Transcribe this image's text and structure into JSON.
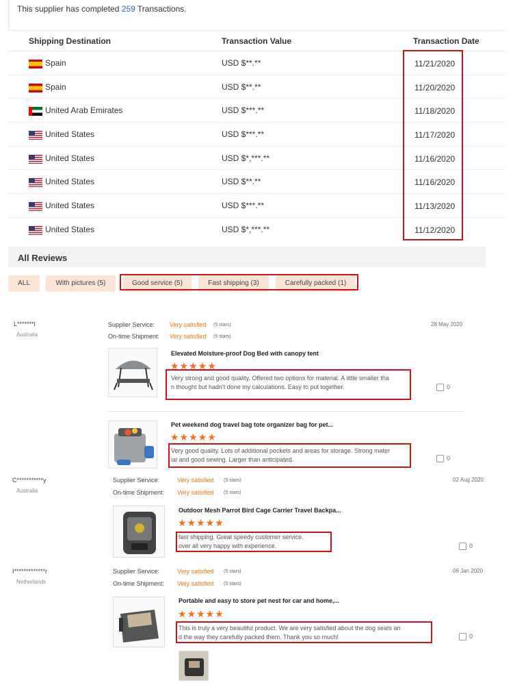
{
  "summary": {
    "prefix": "This supplier has completed",
    "count": "259",
    "suffix": "Transactions."
  },
  "table": {
    "headers": [
      "Shipping Destination",
      "Transaction Value",
      "Transaction Date"
    ],
    "rows": [
      {
        "flag": "spain-flag-icon",
        "country": "Spain",
        "value": "USD $**.**",
        "date": "11/21/2020"
      },
      {
        "flag": "spain-flag-icon",
        "country": "Spain",
        "value": "USD $**.**",
        "date": "11/20/2020"
      },
      {
        "flag": "uae-flag-icon",
        "country": "United Arab Emirates",
        "value": "USD $***.**",
        "date": "11/18/2020"
      },
      {
        "flag": "us-flag-icon",
        "country": "United States",
        "value": "USD $***.**",
        "date": "11/17/2020"
      },
      {
        "flag": "us-flag-icon",
        "country": "United States",
        "value": "USD $*,***.**",
        "date": "11/16/2020"
      },
      {
        "flag": "us-flag-icon",
        "country": "United States",
        "value": "USD $**.**",
        "date": "11/16/2020"
      },
      {
        "flag": "us-flag-icon",
        "country": "United States",
        "value": "USD $***.**",
        "date": "11/13/2020"
      },
      {
        "flag": "us-flag-icon",
        "country": "United States",
        "value": "USD $*,***.**",
        "date": "11/12/2020"
      }
    ]
  },
  "reviews": {
    "title": "All Reviews",
    "filters": [
      "ALL",
      "With pictures (5)",
      "Good service (5)",
      "Fast shipping (3)",
      "Carefully packed (1)"
    ],
    "supplier_service_label": "Supplier Service:",
    "ontime_label": "On-time Shipment:",
    "satisfied": "Very satisfied",
    "five_stars": "(5 stars)",
    "stars": "★★★★★",
    "items": [
      {
        "user": "L*******l",
        "country": "Australia",
        "date": "28 May 2020",
        "products": [
          {
            "title": "Elevated Moisture-proof Dog Bed with canopy tent",
            "text": "Very strong and good quality.  Offered two options for material. A little smaller tha\nn thought but hadn't done my calculations.  Easy to put together.",
            "likes": "0"
          },
          {
            "title": "Pet weekend dog travel bag tote organizer bag for pet...",
            "text": "Very good quality.  Lots of additional pockets and areas for storage.  Strong mater\nial and good sewing.  Larger than anticipated.",
            "likes": "0"
          }
        ]
      },
      {
        "user": "C***********y",
        "country": "Australia",
        "date": "02 Aug 2020",
        "products": [
          {
            "title": "Outdoor Mesh Parrot Bird Cage Carrier Travel Backpa...",
            "text": "fast shipping. Great speedy customer service.\nover all very happy with experience.",
            "likes": "0"
          }
        ]
      },
      {
        "user": "I*************r",
        "country": "Netherlands",
        "date": "06 Jan 2020",
        "products": [
          {
            "title": "Portable and easy to store pet nest for car and home,...",
            "text": "This is truly a very beautiful product. We are very satisfied about the dog seats an\nd the way they carefully packed them. Thank you so much!",
            "likes": "0"
          }
        ]
      }
    ]
  },
  "colors": {
    "accent_orange": "#f37021",
    "highlight_red": "#d0101a",
    "link_blue": "#2a66c2",
    "filter_bg": "#fbe3d6"
  }
}
